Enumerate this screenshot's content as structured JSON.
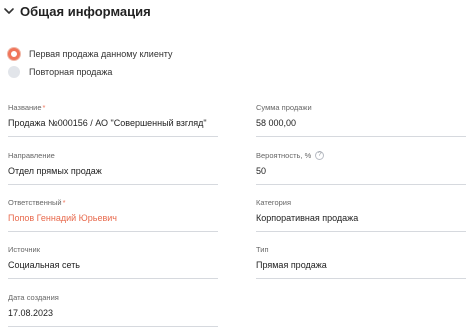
{
  "section": {
    "title": "Общая информация",
    "collapse_icon": "chevron-down-icon"
  },
  "sale_type": {
    "options": [
      {
        "label": "Первая продажа данному клиенту",
        "selected": true
      },
      {
        "label": "Повторная продажа",
        "selected": false
      }
    ]
  },
  "fields": {
    "name": {
      "label": "Название",
      "required": "*",
      "value": "Продажа №000156 / АО \"Совершенный взгляд\""
    },
    "amount": {
      "label": "Сумма продажи",
      "value": "58 000,00"
    },
    "direction": {
      "label": "Направление",
      "value": "Отдел прямых продаж"
    },
    "probability": {
      "label": "Вероятность, %",
      "help": "?",
      "value": "50"
    },
    "responsible": {
      "label": "Ответственный",
      "required": "*",
      "value": "Попов Геннадий Юрьевич"
    },
    "category": {
      "label": "Категория",
      "value": "Корпоративная продажа"
    },
    "source": {
      "label": "Источник",
      "value": "Социальная сеть"
    },
    "type": {
      "label": "Тип",
      "value": "Прямая продажа"
    },
    "created": {
      "label": "Дата создания",
      "value": "17.08.2023"
    }
  },
  "colors": {
    "accent": "#f0755a",
    "link": "#e8694c",
    "divider": "#d6d9de"
  }
}
